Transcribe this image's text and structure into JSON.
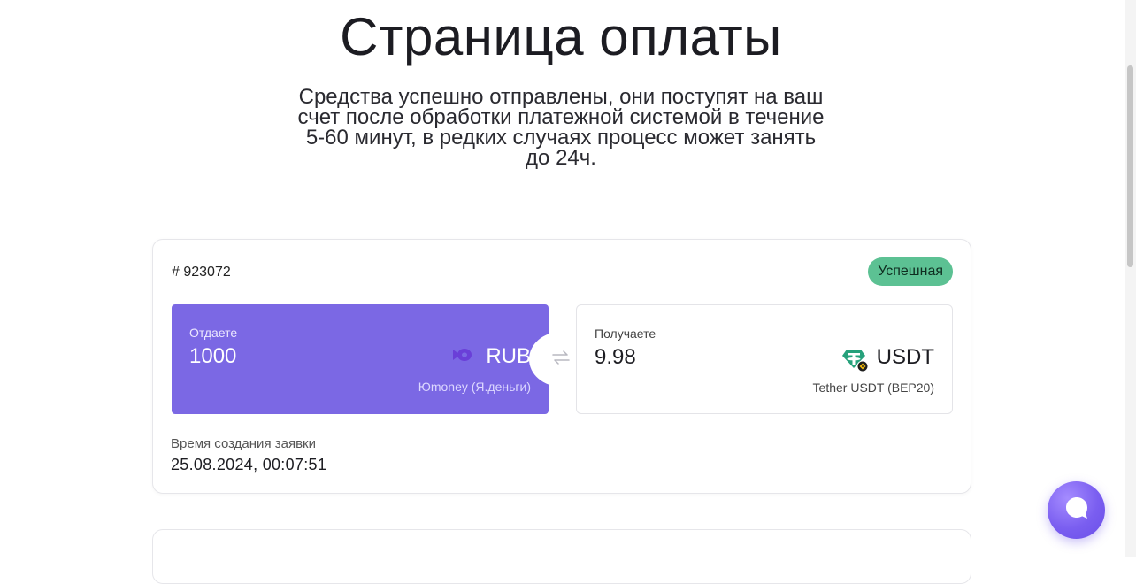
{
  "header": {
    "title": "Страница оплаты",
    "subtitle": "Средства успешно отправлены, они поступят на ваш счет после обработки платежной системой в течение 5-60 минут, в редких случаях процесс может занять до 24ч."
  },
  "order": {
    "id": "# 923072",
    "status": "Успешная",
    "status_color": "#5cc193",
    "give": {
      "label": "Отдаете",
      "amount": "1000",
      "currency": "RUB",
      "method": "Юmoney (Я.деньги)",
      "icon": "yoomoney-icon",
      "background": "#7b68e4"
    },
    "receive": {
      "label": "Получаете",
      "amount": "9.98",
      "currency": "USDT",
      "method": "Tether USDT (BEP20)",
      "icon": "tether-icon"
    },
    "swap_icon": "swap-arrows-icon",
    "created": {
      "label": "Время создания заявки",
      "value": "25.08.2024, 00:07:51"
    }
  },
  "second_card": {
    "text": ""
  },
  "chat": {
    "icon": "chat-bubble-icon",
    "color": "#7a5ef0"
  }
}
